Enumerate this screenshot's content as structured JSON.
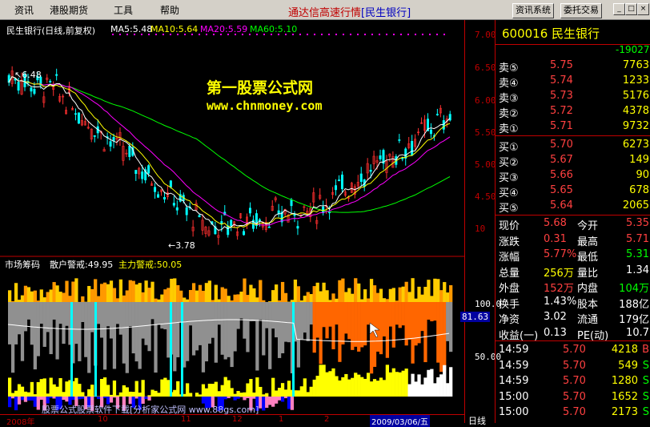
{
  "menus": [
    "资讯",
    "港股期货",
    "工具",
    "帮助"
  ],
  "app_title": "通达信高速行情",
  "stock_tag": "[民生银行]",
  "buttons": {
    "info": "资讯系统",
    "trade": "委托交易"
  },
  "chart": {
    "header": "民生银行(日线,前复权)",
    "ma5": "MA5:5.48",
    "ma10": "MA10:5.64",
    "ma20": "MA20:5.59",
    "ma60": "MA60:5.10",
    "high_label": "6.48",
    "low_label": "3.78",
    "watermark_cn": "第一股票公式网",
    "watermark_url": "www.chnmoney.com",
    "lower_header": "市场筹码",
    "retail": "散户警戒:49.95",
    "main": "主力警戒:50.05",
    "bottom_caption": "股票公式股票软件下载[分析家公式网 www.88gs.com]",
    "date_axis": [
      "2008年",
      "10",
      "11",
      "12",
      "1",
      "2",
      "2009/03/06/五"
    ],
    "period": "日线",
    "colors": {
      "ma5": "#ffffff",
      "ma10": "#ffff00",
      "ma20": "#ff00ff",
      "ma60": "#00ff00",
      "up": "#ff3030",
      "down": "#00ffff",
      "accent": "#c00000"
    }
  },
  "price_axis": [
    "7.00",
    "6.50",
    "6.00",
    "5.50",
    "5.00",
    "4.50",
    "10",
    "100.0",
    "81.63",
    "50.00"
  ],
  "quote": {
    "code_name": "600016 民生银行",
    "committee": "-19027",
    "asks": [
      {
        "label": "卖⑤",
        "price": "5.75",
        "vol": "7763"
      },
      {
        "label": "卖④",
        "price": "5.74",
        "vol": "1233"
      },
      {
        "label": "卖③",
        "price": "5.73",
        "vol": "5176"
      },
      {
        "label": "卖②",
        "price": "5.72",
        "vol": "4378"
      },
      {
        "label": "卖①",
        "price": "5.71",
        "vol": "9732"
      }
    ],
    "bids": [
      {
        "label": "买①",
        "price": "5.70",
        "vol": "6273"
      },
      {
        "label": "买②",
        "price": "5.67",
        "vol": "149"
      },
      {
        "label": "买③",
        "price": "5.66",
        "vol": "90"
      },
      {
        "label": "买④",
        "price": "5.65",
        "vol": "678"
      },
      {
        "label": "买⑤",
        "price": "5.64",
        "vol": "2065"
      }
    ],
    "stats": [
      {
        "l1": "现价",
        "v1": "5.68",
        "l2": "今开",
        "v2": "5.35"
      },
      {
        "l1": "涨跌",
        "v1": "0.31",
        "l2": "最高",
        "v2": "5.71"
      },
      {
        "l1": "涨幅",
        "v1": "5.77%",
        "l2": "最低",
        "v2": "5.31"
      },
      {
        "l1": "总量",
        "v1": "256万",
        "l2": "量比",
        "v2": "1.34"
      },
      {
        "l1": "外盘",
        "v1": "152万",
        "l2": "内盘",
        "v2": "104万"
      },
      {
        "l1": "换手",
        "v1": "1.43%",
        "l2": "股本",
        "v2": "188亿"
      },
      {
        "l1": "净资",
        "v1": "3.02",
        "l2": "流通",
        "v2": "179亿"
      },
      {
        "l1": "收益(一)",
        "v1": "0.13",
        "l2": "PE(动)",
        "v2": "10.7"
      }
    ],
    "ticks": [
      {
        "time": "14:59",
        "price": "5.70",
        "vol": "4218",
        "bs": "B"
      },
      {
        "time": "14:59",
        "price": "5.70",
        "vol": "549",
        "bs": "S"
      },
      {
        "time": "14:59",
        "price": "5.70",
        "vol": "1280",
        "bs": "S"
      },
      {
        "time": "15:00",
        "price": "5.70",
        "vol": "1652",
        "bs": "S"
      },
      {
        "time": "15:00",
        "price": "5.70",
        "vol": "2173",
        "bs": "S"
      }
    ]
  }
}
